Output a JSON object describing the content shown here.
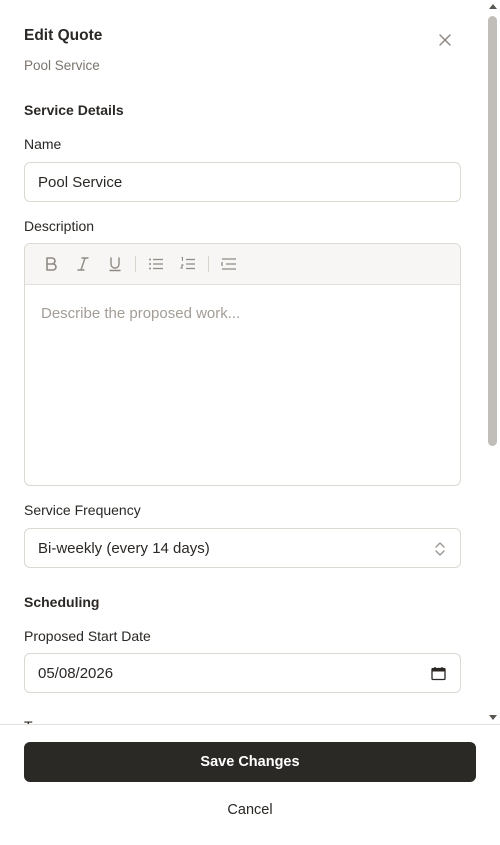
{
  "header": {
    "title": "Edit Quote",
    "subtitle": "Pool Service",
    "close_icon": "close-icon"
  },
  "sections": {
    "service_details": "Service Details",
    "scheduling": "Scheduling"
  },
  "fields": {
    "name": {
      "label": "Name",
      "value": "Pool Service"
    },
    "description": {
      "label": "Description",
      "placeholder": "Describe the proposed work...",
      "toolbar": [
        "bold-icon",
        "italic-icon",
        "underline-icon",
        "bullet-list-icon",
        "numbered-list-icon",
        "indent-icon"
      ]
    },
    "frequency": {
      "label": "Service Frequency",
      "value": "Bi-weekly (every 14 days)"
    },
    "start_date": {
      "label": "Proposed Start Date",
      "value": "05/08/2026"
    },
    "next_label": "T"
  },
  "footer": {
    "save_label": "Save Changes",
    "cancel_label": "Cancel"
  },
  "colors": {
    "primary_button": "#2b2926",
    "border": "#dcd8d2",
    "muted_text": "#7a746d"
  }
}
